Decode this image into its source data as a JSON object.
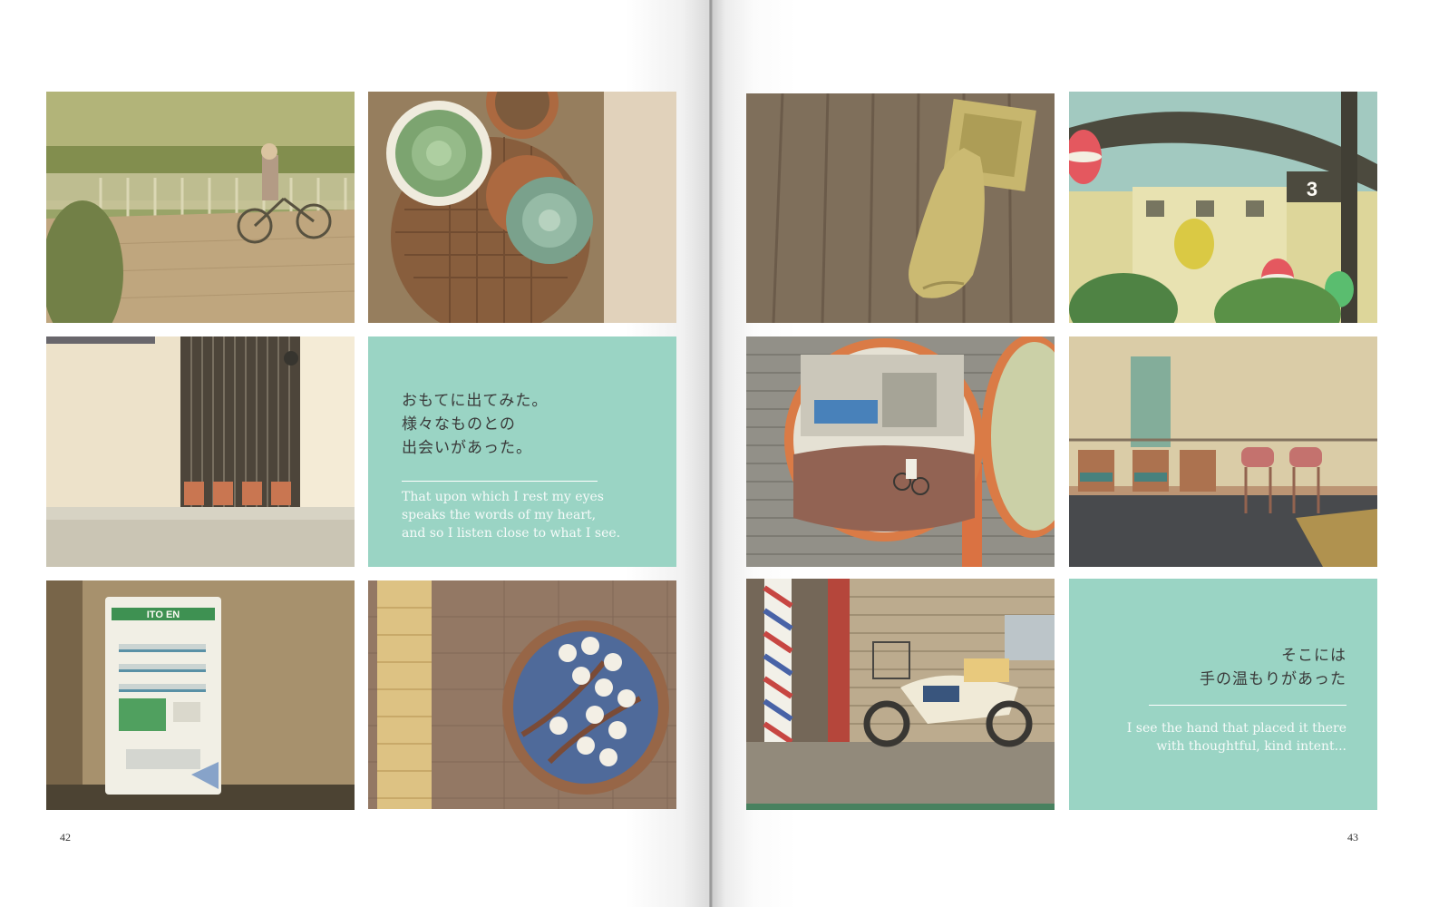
{
  "left_page": {
    "folio": "42",
    "quote_tile": {
      "jp_lines": [
        "おもてに出てみた。",
        "様々なものとの",
        "出会いがあった。"
      ],
      "en_lines": [
        "That upon which I rest my eyes",
        "speaks the words of my heart,",
        "and so I listen close to what I see."
      ]
    }
  },
  "right_page": {
    "folio": "43",
    "quote_tile": {
      "jp_lines": [
        "そこには",
        "手の温もりがあった"
      ],
      "en_lines": [
        "I see the hand that placed it there",
        "with thoughtful, kind intent..."
      ]
    }
  },
  "photos": {
    "vending_machine_brand": "ITO EN",
    "station_sign_number": "3"
  },
  "colors": {
    "accent_tile": "#9ad4c4",
    "page": "#ffffff",
    "ink": "#3a3a3a"
  }
}
